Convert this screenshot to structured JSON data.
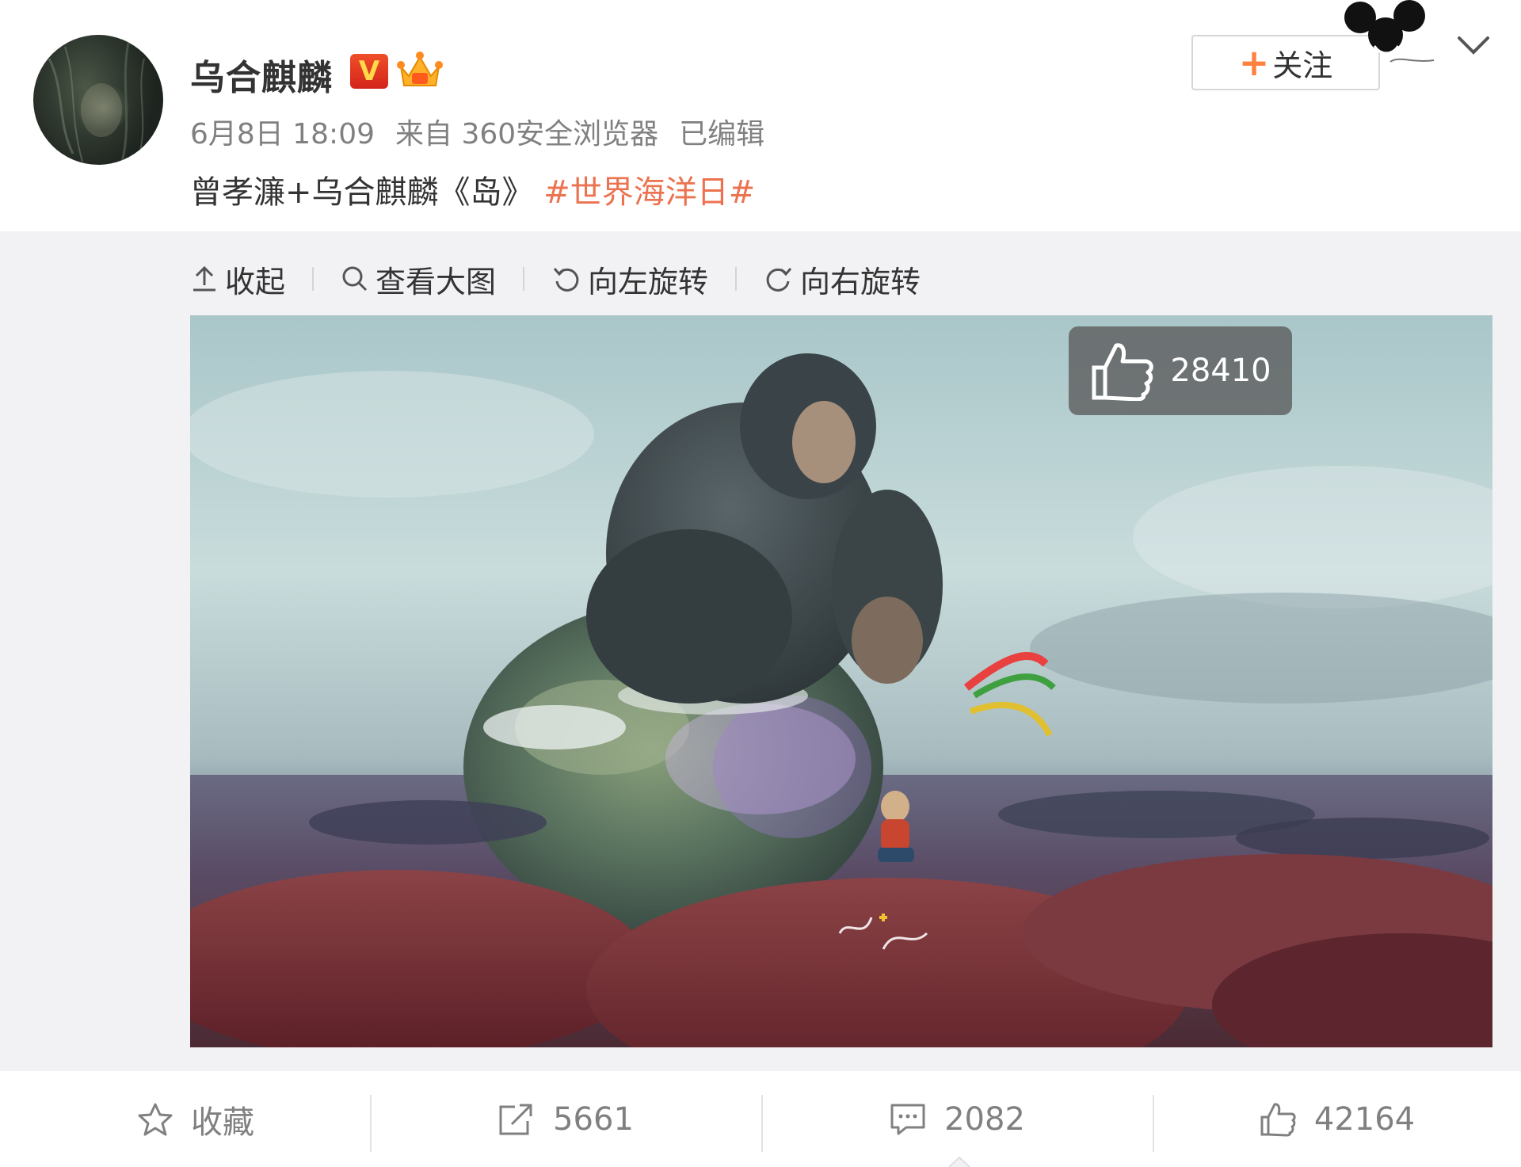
{
  "header": {
    "username": "乌合麒麟",
    "verified_badge": "V",
    "post_date": "6月8日 18:09",
    "post_source": "来自 360安全浏览器",
    "edited_label": "已编辑",
    "post_text": "曾孝濂+乌合麒麟《岛》",
    "hashtag": "#世界海洋日#",
    "follow_plus": "+",
    "follow_label": "关注",
    "icons": [
      "avatar",
      "verified-v-icon",
      "crown-badge-icon",
      "mickey-icon",
      "chevron-down-icon"
    ]
  },
  "toolbar": {
    "collapse_label": "收起",
    "view_large_label": "查看大图",
    "rotate_left_label": "向左旋转",
    "rotate_right_label": "向右旋转",
    "icons": [
      "upload-arrow-icon",
      "search-icon",
      "rotate-left-icon",
      "rotate-right-icon"
    ]
  },
  "image": {
    "like_count": "28410",
    "icons": [
      "thumbs-up-icon"
    ]
  },
  "actions": {
    "favorite_label": "收藏",
    "repost_count": "5661",
    "comment_count": "2082",
    "like_count": "42164",
    "icons": [
      "star-icon",
      "share-icon",
      "comment-icon",
      "thumbs-up-icon"
    ]
  },
  "colors": {
    "hashtag": "#eb7350",
    "follow_plus": "#ff8140",
    "badge_v": "#e12f1f",
    "gallery_bg": "#f2f2f5"
  }
}
